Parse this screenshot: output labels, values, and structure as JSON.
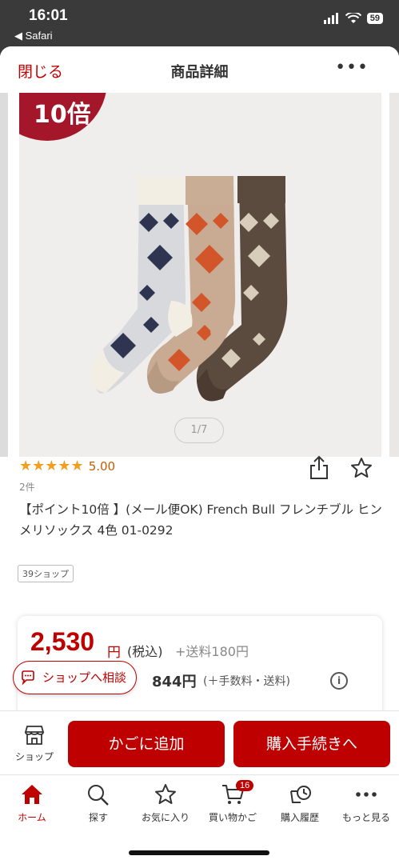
{
  "status": {
    "time": "16:01",
    "back_label": "◀ Safari",
    "battery": "59"
  },
  "nav": {
    "close_label": "閉じる",
    "title": "商品詳細",
    "more_label": "•••"
  },
  "gallery": {
    "badge_text": "10倍",
    "pager": "1/7"
  },
  "product": {
    "stars": "★★★★★",
    "rating": "5.00",
    "review_count": "2件",
    "title": "【ポイント10倍 】(メール便OK) French Bull フレンチブル ヒンメリソックス 4色 01-0292",
    "shop_tag": "39ショップ"
  },
  "price": {
    "amount": "2,530",
    "unit": "円",
    "tax": "(税込)",
    "shipping": "+送料180円",
    "sub_amount": "844円",
    "sub_note": "(＋手数料・送料)"
  },
  "consult": {
    "label": "ショップへ相談"
  },
  "actions": {
    "shop_label": "ショップ",
    "add_cart": "かごに追加",
    "checkout": "購入手続きへ"
  },
  "tabs": [
    {
      "label": "ホーム"
    },
    {
      "label": "探す"
    },
    {
      "label": "お気に入り"
    },
    {
      "label": "買い物かご",
      "badge": "16"
    },
    {
      "label": "購入履歴"
    },
    {
      "label": "もっと見る"
    }
  ],
  "colors": {
    "brand": "#bf0000",
    "star": "#f0a020",
    "badge": "#a4162a"
  }
}
